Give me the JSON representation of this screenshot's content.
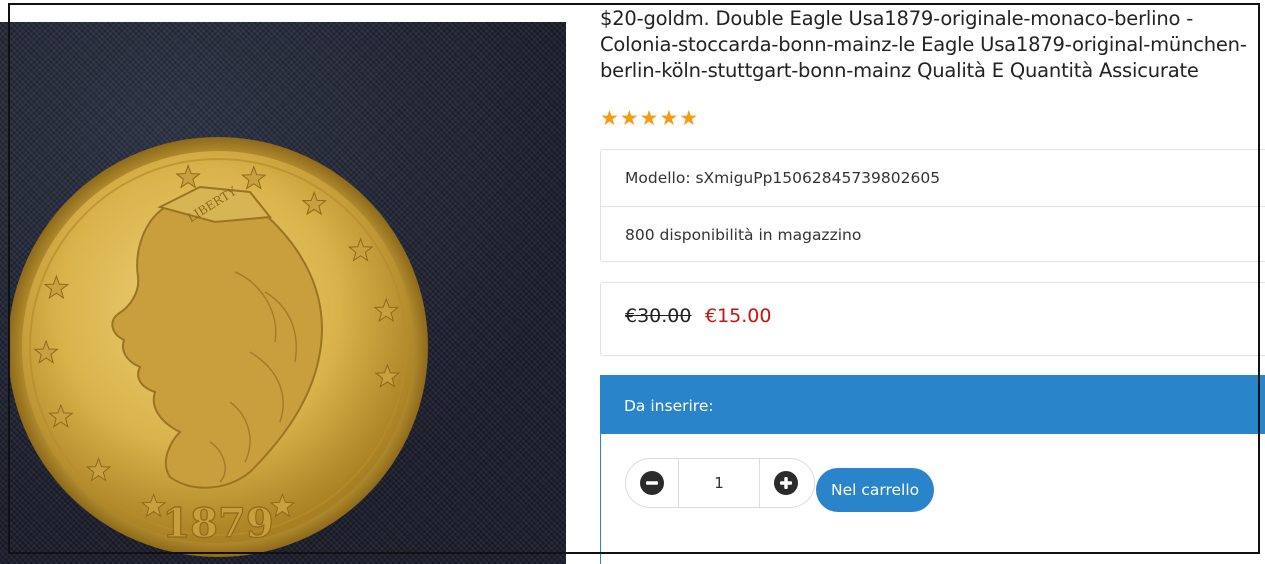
{
  "product": {
    "title": "$20-goldm. Double Eagle Usa1879-originale-monaco-berlino - Colonia-stoccarda-bonn-mainz-le Eagle Usa1879-original-münchen-berlin-köln-stuttgart-bonn-mainz Qualità E Quantità Assicurate",
    "rating": 5,
    "rating_icon": "star-icon",
    "model": "Modello: sXmiguPp15062845739802605",
    "stock": "800 disponibilità in magazzino",
    "price_old": "€30.00",
    "price_new": "€15.00",
    "coin_text": {
      "liberty": "LIBERTY",
      "year": "1879"
    }
  },
  "cart": {
    "header": "Da inserire:",
    "quantity": "1",
    "add_label": "Nel carrello",
    "minus_icon": "minus-circle-icon",
    "plus_icon": "plus-circle-icon"
  },
  "colors": {
    "accent": "#2a84c9",
    "star": "#f39c12",
    "sale_price": "#cc1111",
    "coin_gold": "#d9b24a"
  }
}
